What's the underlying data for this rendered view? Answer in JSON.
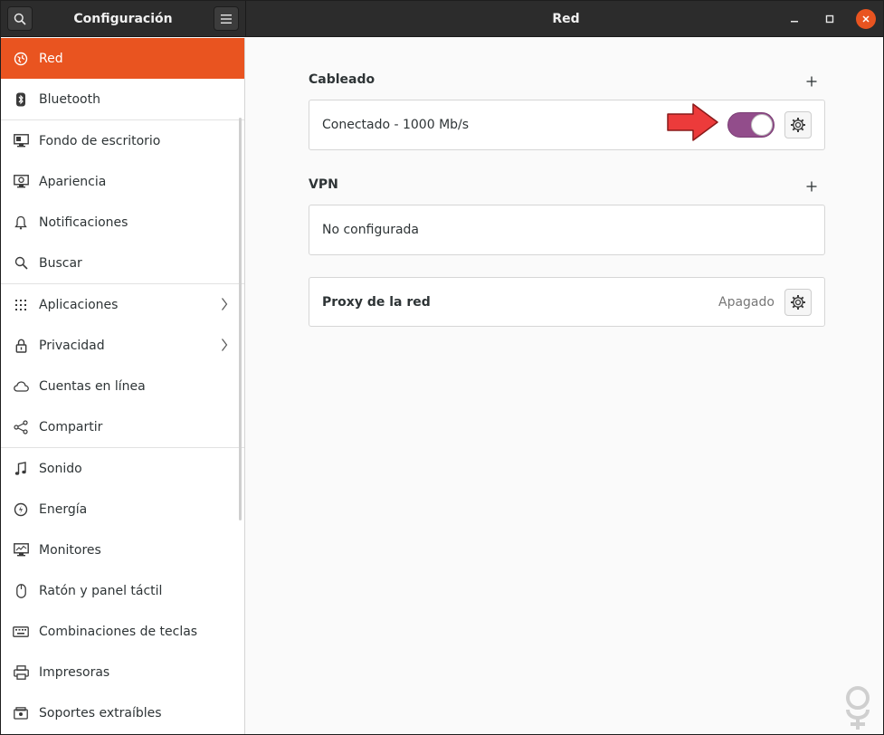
{
  "app": {
    "sidebar_title": "Configuración",
    "page_title": "Red"
  },
  "sidebar": {
    "items": [
      {
        "label": "Red",
        "icon": "network-icon"
      },
      {
        "label": "Bluetooth",
        "icon": "bluetooth-icon"
      },
      {
        "label": "Fondo de escritorio",
        "icon": "background-icon"
      },
      {
        "label": "Apariencia",
        "icon": "appearance-icon"
      },
      {
        "label": "Notificaciones",
        "icon": "bell-icon"
      },
      {
        "label": "Buscar",
        "icon": "search-icon"
      },
      {
        "label": "Aplicaciones",
        "icon": "apps-grid-icon"
      },
      {
        "label": "Privacidad",
        "icon": "lock-icon"
      },
      {
        "label": "Cuentas en línea",
        "icon": "cloud-icon"
      },
      {
        "label": "Compartir",
        "icon": "share-icon"
      },
      {
        "label": "Sonido",
        "icon": "music-note-icon"
      },
      {
        "label": "Energía",
        "icon": "power-icon"
      },
      {
        "label": "Monitores",
        "icon": "monitor-icon"
      },
      {
        "label": "Ratón y panel táctil",
        "icon": "mouse-icon"
      },
      {
        "label": "Combinaciones de teclas",
        "icon": "keyboard-icon"
      },
      {
        "label": "Impresoras",
        "icon": "printer-icon"
      },
      {
        "label": "Soportes extraíbles",
        "icon": "removable-media-icon"
      }
    ]
  },
  "main": {
    "wired": {
      "title": "Cableado",
      "connection_label": "Conectado - 1000 Mb/s",
      "toggle_on": true
    },
    "vpn": {
      "title": "VPN",
      "status": "No configurada"
    },
    "proxy": {
      "label": "Proxy de la red",
      "status": "Apagado"
    }
  },
  "colors": {
    "accent": "#e95420",
    "toggle": "#924d8b",
    "arrow": "#ec3b3b"
  }
}
